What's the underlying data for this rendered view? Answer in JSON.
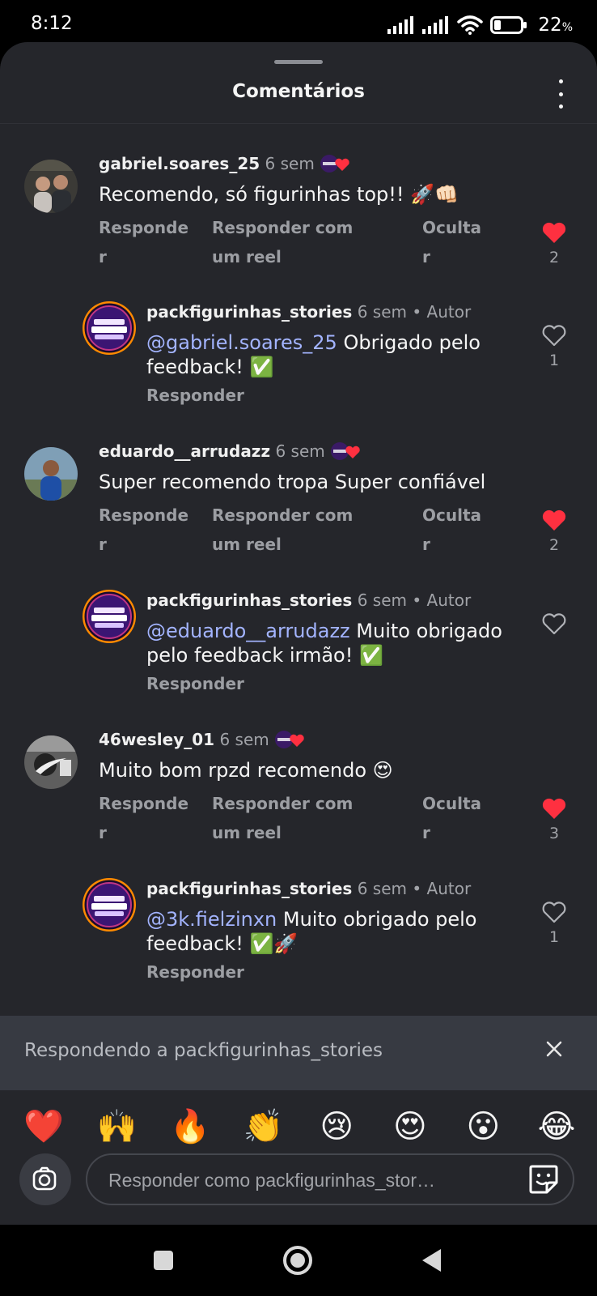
{
  "status_bar": {
    "time": "8:12",
    "battery": "22",
    "battery_unit": "%"
  },
  "header": {
    "title": "Comentários"
  },
  "comments": [
    {
      "user": "gabriel.soares_25",
      "time": "6 sem",
      "text": "Recomendo, só figurinhas top!! 🚀👊🏻",
      "reply_label": "Responder",
      "reel_label": "Responder com um reel",
      "hide_label": "Ocultar",
      "likes": "2",
      "liked": true,
      "avatar_color": "#3b3a36"
    },
    {
      "user": "packfigurinhas_stories",
      "time": "6 sem",
      "author_label": "Autor",
      "mention": "@gabriel.soares_25",
      "text": " Obrigado pelo feedback! ✅",
      "reply_label": "Responder",
      "likes": "1",
      "liked": false
    },
    {
      "user": "eduardo__arrudazz",
      "time": "6 sem",
      "text": "Super recomendo  tropa  Super confiável",
      "reply_label": "Responder",
      "reel_label": "Responder com um reel",
      "hide_label": "Ocultar",
      "likes": "2",
      "liked": true,
      "avatar_color": "#6f8fa8"
    },
    {
      "user": "packfigurinhas_stories",
      "time": "6 sem",
      "author_label": "Autor",
      "mention": "@eduardo__arrudazz",
      "text": " Muito obrigado pelo feedback irmão! ✅",
      "reply_label": "Responder",
      "likes": "",
      "liked": false
    },
    {
      "user": "46wesley_01",
      "time": "6 sem",
      "text": "Muito bom rpzd recomendo 😍",
      "reply_label": "Responder",
      "reel_label": "Responder com um reel",
      "hide_label": "Ocultar",
      "likes": "3",
      "liked": true,
      "avatar_color": "#888888"
    },
    {
      "user": "packfigurinhas_stories",
      "time": "6 sem",
      "author_label": "Autor",
      "mention": "@3k.fielzinxn",
      "text": " Muito obrigado pelo feedback! ✅🚀",
      "reply_label": "Responder",
      "likes": "1",
      "liked": false
    }
  ],
  "replying_bar": {
    "text": "Respondendo a packfigurinhas_stories"
  },
  "quick_emojis": [
    "❤️",
    "🙌",
    "🔥",
    "👏",
    "😢",
    "😍",
    "😮",
    "😂"
  ],
  "composer": {
    "placeholder": "Responder como packfigurinhas_stor…"
  },
  "colors": {
    "like_red": "#ff3040",
    "sheet_bg": "#25262b",
    "mention": "#a3b4ff"
  }
}
